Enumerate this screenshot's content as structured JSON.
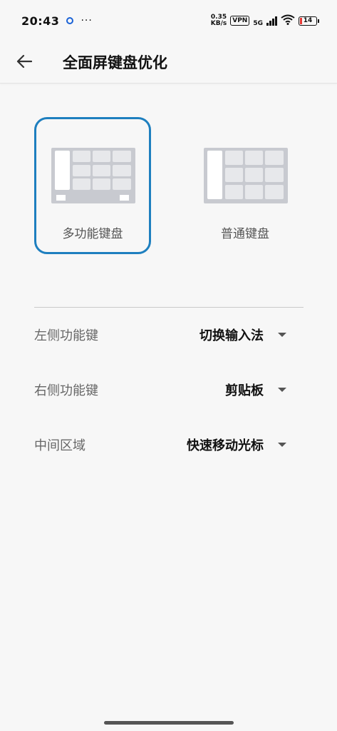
{
  "status_bar": {
    "time": "20:43",
    "more": "···",
    "net_speed_value": "0.35",
    "net_speed_unit": "KB/s",
    "vpn": "VPN",
    "network": "5G",
    "battery": "14"
  },
  "header": {
    "title": "全面屏键盘优化"
  },
  "keyboard_options": [
    {
      "label": "多功能键盘",
      "selected": true
    },
    {
      "label": "普通键盘",
      "selected": false
    }
  ],
  "settings": [
    {
      "label": "左侧功能键",
      "value": "切换输入法"
    },
    {
      "label": "右侧功能键",
      "value": "剪贴板"
    },
    {
      "label": "中间区域",
      "value": "快速移动光标"
    }
  ],
  "colors": {
    "accent": "#1e7fbf",
    "keyboard_body": "#c8cad0",
    "key": "#e7e8eb",
    "battery_low": "#e53935"
  }
}
